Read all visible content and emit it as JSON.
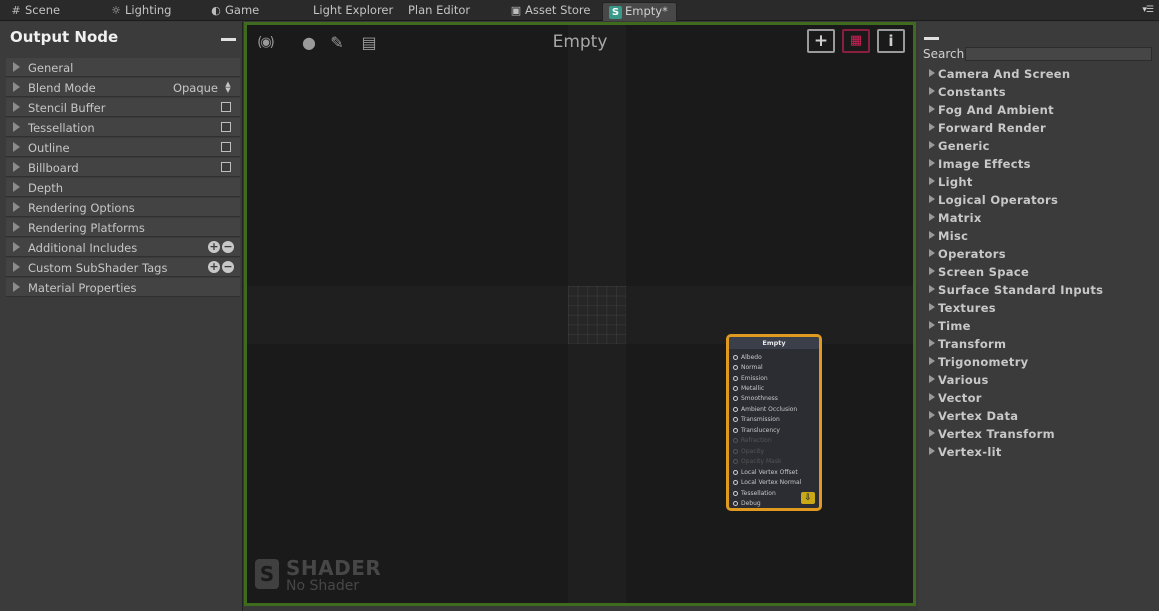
{
  "tabs": [
    {
      "label": "Scene",
      "icon": "#"
    },
    {
      "label": "Lighting",
      "icon": "☼"
    },
    {
      "label": "Game",
      "icon": "◐"
    },
    {
      "label": "Light Explorer",
      "icon": "☼"
    },
    {
      "label": "Plan Editor",
      "icon": ""
    },
    {
      "label": "Asset Store",
      "icon": "▣"
    },
    {
      "label": "Empty*",
      "icon": "S"
    }
  ],
  "left_panel": {
    "title": "Output Node",
    "rows": [
      {
        "label": "General"
      },
      {
        "label": "Blend Mode",
        "value": "Opaque"
      },
      {
        "label": "Stencil Buffer"
      },
      {
        "label": "Tessellation"
      },
      {
        "label": "Outline"
      },
      {
        "label": "Billboard"
      },
      {
        "label": "Depth"
      },
      {
        "label": "Rendering Options"
      },
      {
        "label": "Rendering Platforms"
      },
      {
        "label": "Additional Includes"
      },
      {
        "label": "Custom SubShader Tags"
      },
      {
        "label": "Material Properties"
      }
    ]
  },
  "canvas": {
    "title": "Empty",
    "node": {
      "title": "Empty",
      "ports": [
        "Albedo",
        "Normal",
        "Emission",
        "Metallic",
        "Smoothness",
        "Ambient Occlusion",
        "Transmission",
        "Translucency",
        "Refraction",
        "Opacity",
        "Opacity Mask",
        "Local Vertex Offset",
        "Local Vertex Normal",
        "Tessellation",
        "Debug"
      ]
    },
    "watermark": {
      "title": "SHADER",
      "subtitle": "No Shader"
    }
  },
  "right_panel": {
    "search_label": "Search",
    "search_value": "",
    "categories": [
      "Camera And Screen",
      "Constants",
      "Fog And Ambient",
      "Forward Render",
      "Generic",
      "Image Effects",
      "Light",
      "Logical Operators",
      "Matrix",
      "Misc",
      "Operators",
      "Screen Space",
      "Surface Standard Inputs",
      "Textures",
      "Time",
      "Transform",
      "Trigonometry",
      "Various",
      "Vector",
      "Vertex Data",
      "Vertex Transform",
      "Vertex-lit"
    ]
  }
}
